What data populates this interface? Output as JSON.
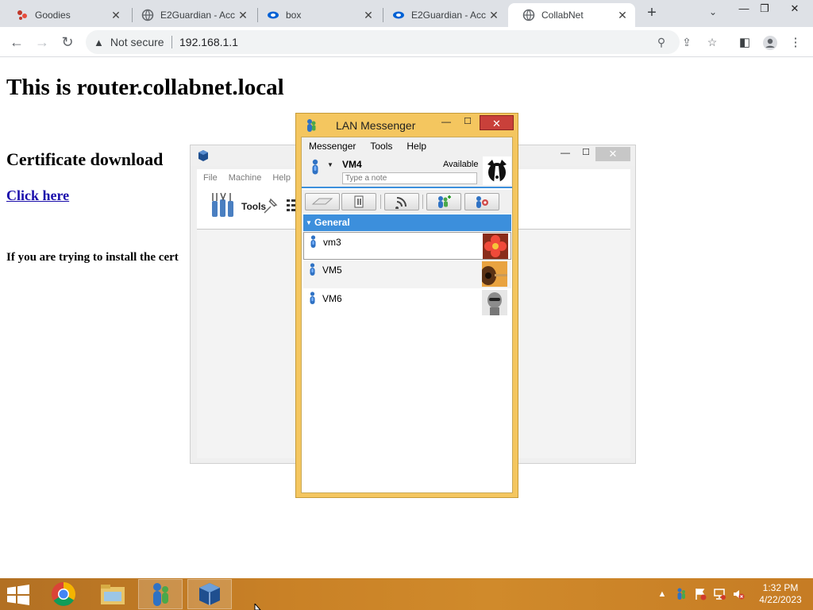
{
  "browser": {
    "tabs": [
      {
        "title": "Goodies",
        "icon": "goodies-icon",
        "active": false
      },
      {
        "title": "E2Guardian - Acc",
        "icon": "globe-icon",
        "active": false
      },
      {
        "title": "box",
        "icon": "box-icon",
        "active": false
      },
      {
        "title": "E2Guardian - Acc",
        "icon": "box-icon",
        "active": false
      },
      {
        "title": "CollabNet",
        "icon": "globe-icon",
        "active": true
      }
    ],
    "security_label": "Not secure",
    "url": "192.168.1.1"
  },
  "page": {
    "heading": "This is router.collabnet.local",
    "subheading": "Certificate download",
    "link_text": "Click here",
    "note": "If you are trying to install the cert"
  },
  "virtualbox": {
    "menu": [
      "File",
      "Machine",
      "Help"
    ],
    "tools_label": "Tools"
  },
  "lan_messenger": {
    "title": "LAN Messenger",
    "menu": [
      "Messenger",
      "Tools",
      "Help"
    ],
    "username": "VM4",
    "availability": "Available",
    "note_placeholder": "Type a note",
    "group_name": "General",
    "contacts": [
      {
        "name": "vm3",
        "avatar": "flower-avatar",
        "selected": true
      },
      {
        "name": "VM5",
        "avatar": "guitar-avatar",
        "selected": false
      },
      {
        "name": "VM6",
        "avatar": "robot-avatar",
        "selected": false
      }
    ],
    "accent_color": "#3c8fdc",
    "frame_color": "#f4c65f"
  },
  "taskbar": {
    "apps": [
      "chrome",
      "file-explorer",
      "lan-messenger",
      "virtualbox"
    ],
    "time": "1:32 PM",
    "date": "4/22/2023",
    "color": "#c98126"
  }
}
